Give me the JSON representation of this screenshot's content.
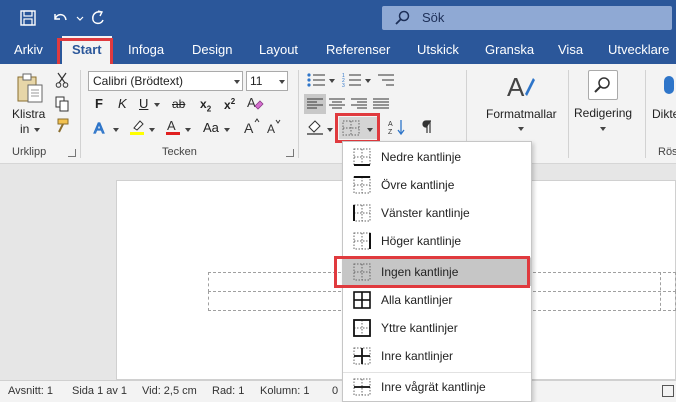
{
  "search": {
    "placeholder": "Sök",
    "icon": "search-icon"
  },
  "tabs": [
    {
      "label": "Arkiv"
    },
    {
      "label": "Start",
      "active": true
    },
    {
      "label": "Infoga"
    },
    {
      "label": "Design"
    },
    {
      "label": "Layout"
    },
    {
      "label": "Referenser"
    },
    {
      "label": "Utskick"
    },
    {
      "label": "Granska"
    },
    {
      "label": "Visa"
    },
    {
      "label": "Utvecklare"
    }
  ],
  "ribbon": {
    "clipboard": {
      "paste_label_1": "Klistra",
      "paste_label_2": "in",
      "group": "Urklipp"
    },
    "font": {
      "name": "Calibri (Brödtext)",
      "size": "11",
      "group": "Tecken",
      "change_case": "Aa"
    },
    "styles": {
      "label": "Formatmallar"
    },
    "editing": {
      "label": "Redigering"
    },
    "dictate": {
      "label": "Dikte",
      "group": "Rös"
    }
  },
  "border_menu": {
    "items": [
      {
        "label": "Nedre kantlinje",
        "icon": "bottom-border-icon"
      },
      {
        "label": "Övre kantlinje",
        "icon": "top-border-icon"
      },
      {
        "label": "Vänster kantlinje",
        "icon": "left-border-icon"
      },
      {
        "label": "Höger kantlinje",
        "icon": "right-border-icon"
      },
      {
        "label": "Ingen kantlinje",
        "icon": "no-border-icon",
        "selected": true
      },
      {
        "label": "Alla kantlinjer",
        "icon": "all-borders-icon"
      },
      {
        "label": "Yttre kantlinjer",
        "icon": "outside-borders-icon"
      },
      {
        "label": "Inre kantlinjer",
        "icon": "inside-borders-icon"
      },
      {
        "label": "Inre vågrät kantlinje",
        "icon": "inside-horizontal-border-icon"
      }
    ]
  },
  "status": {
    "section": "Avsnitt: 1",
    "page": "Sida 1 av 1",
    "position": "Vid: 2,5 cm",
    "line": "Rad: 1",
    "column": "Kolumn: 1",
    "extra": "0"
  },
  "colors": {
    "brand": "#2b579a",
    "highlight": "#e03a3e",
    "selected_item": "#c6c6c6"
  }
}
